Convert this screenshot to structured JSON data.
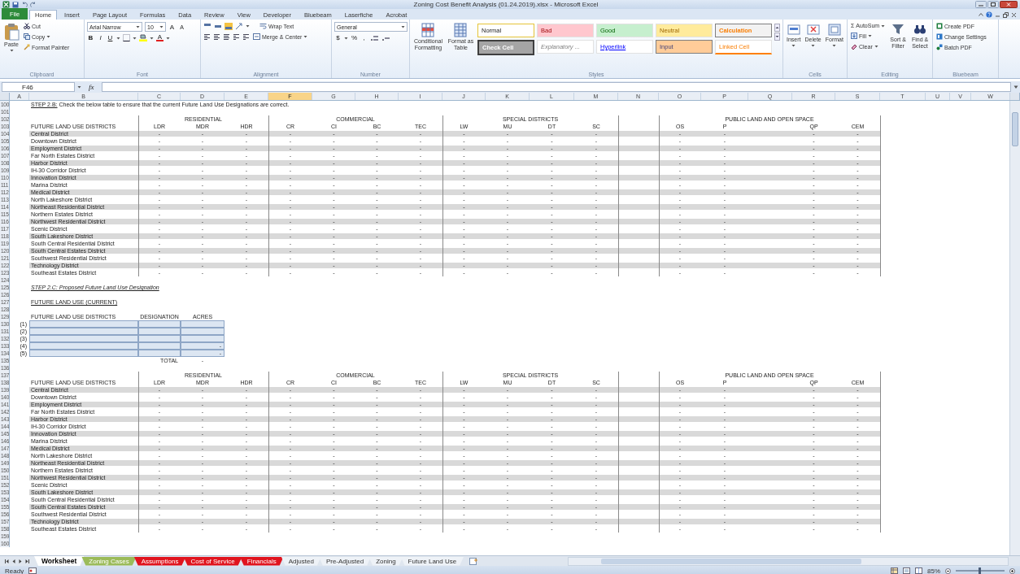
{
  "window": {
    "title": "Zoning Cost Benefit Analysis (01.24.2019).xlsx - Microsoft Excel"
  },
  "ribbon_tabs": [
    {
      "label": "File",
      "kind": "file",
      "selected": false
    },
    {
      "label": "Home",
      "kind": "tab",
      "selected": true
    },
    {
      "label": "Insert",
      "kind": "tab",
      "selected": false
    },
    {
      "label": "Page Layout",
      "kind": "tab",
      "selected": false
    },
    {
      "label": "Formulas",
      "kind": "tab",
      "selected": false
    },
    {
      "label": "Data",
      "kind": "tab",
      "selected": false
    },
    {
      "label": "Review",
      "kind": "tab",
      "selected": false
    },
    {
      "label": "View",
      "kind": "tab",
      "selected": false
    },
    {
      "label": "Developer",
      "kind": "tab",
      "selected": false
    },
    {
      "label": "Bluebeam",
      "kind": "tab",
      "selected": false
    },
    {
      "label": "Laserfiche",
      "kind": "tab",
      "selected": false
    },
    {
      "label": "Acrobat",
      "kind": "tab",
      "selected": false
    }
  ],
  "clipboard": {
    "label": "Clipboard",
    "paste": "Paste",
    "cut": "Cut",
    "copy": "Copy",
    "format_painter": "Format Painter"
  },
  "font": {
    "label": "Font",
    "name": "Arial Narrow",
    "size": "10",
    "grow": "A",
    "shrink": "A",
    "bold": "B",
    "italic": "I",
    "underline": "U",
    "font_color_letter": "A"
  },
  "alignment": {
    "label": "Alignment",
    "wrap_text": "Wrap Text",
    "merge": "Merge & Center"
  },
  "number": {
    "label": "Number",
    "format": "General",
    "currency": "$",
    "percent": "%",
    "comma": ","
  },
  "styles": {
    "label": "Styles",
    "conditional": "Conditional Formatting",
    "format_table": "Format as Table",
    "gallery": [
      {
        "label": "Normal",
        "kind": "normal"
      },
      {
        "label": "Bad",
        "kind": "bad"
      },
      {
        "label": "Good",
        "kind": "good"
      },
      {
        "label": "Neutral",
        "kind": "neutral"
      },
      {
        "label": "Calculation",
        "kind": "calculation"
      },
      {
        "label": "Check Cell",
        "kind": "check"
      },
      {
        "label": "Explanatory ...",
        "kind": "explanatory"
      },
      {
        "label": "Hyperlink",
        "kind": "hyperlink"
      },
      {
        "label": "Input",
        "kind": "input"
      },
      {
        "label": "Linked Cell",
        "kind": "linked"
      }
    ]
  },
  "cells": {
    "label": "Cells",
    "buttons": [
      "Insert",
      "Delete",
      "Format"
    ]
  },
  "editing": {
    "label": "Editing",
    "sigma": "Σ",
    "autosum": "AutoSum",
    "fill": "Fill",
    "clear": "Clear",
    "sort": "Sort & Filter",
    "find": "Find & Select"
  },
  "bluebeam": {
    "label": "Bluebeam",
    "buttons": [
      "Create PDF",
      "Change Settings",
      "Batch PDF"
    ]
  },
  "formula_bar": {
    "name_box": "F46",
    "fx": "fx"
  },
  "columns": [
    {
      "label": "A",
      "selected": false
    },
    {
      "label": "B",
      "selected": false
    },
    {
      "label": "C",
      "selected": false
    },
    {
      "label": "D",
      "selected": false
    },
    {
      "label": "E",
      "selected": false
    },
    {
      "label": "F",
      "selected": true
    },
    {
      "label": "G",
      "selected": false
    },
    {
      "label": "H",
      "selected": false
    },
    {
      "label": "I",
      "selected": false
    },
    {
      "label": "J",
      "selected": false
    },
    {
      "label": "K",
      "selected": false
    },
    {
      "label": "L",
      "selected": false
    },
    {
      "label": "M",
      "selected": false
    },
    {
      "label": "N",
      "selected": false
    },
    {
      "label": "O",
      "selected": false
    },
    {
      "label": "P",
      "selected": false
    },
    {
      "label": "Q",
      "selected": false
    },
    {
      "label": "R",
      "selected": false
    },
    {
      "label": "S",
      "selected": false
    },
    {
      "label": "T",
      "selected": false
    },
    {
      "label": "U",
      "selected": false
    },
    {
      "label": "V",
      "selected": false
    },
    {
      "label": "W",
      "selected": false
    }
  ],
  "row_numbers": [
    "100",
    "101",
    "102",
    "103",
    "104",
    "105",
    "106",
    "107",
    "108",
    "109",
    "110",
    "111",
    "112",
    "113",
    "114",
    "115",
    "116",
    "117",
    "118",
    "119",
    "120",
    "121",
    "122",
    "123",
    "124",
    "125",
    "126",
    "127",
    "128",
    "129",
    "130",
    "131",
    "132",
    "133",
    "134",
    "135",
    "136",
    "137",
    "138",
    "139",
    "140",
    "141",
    "142",
    "143",
    "144",
    "145",
    "146",
    "147",
    "148",
    "149",
    "150",
    "151",
    "152",
    "153",
    "154",
    "155",
    "156",
    "157",
    "158",
    "159",
    "160"
  ],
  "step_2b": {
    "label": "STEP 2.B:",
    "text": "Check the below table to ensure that the current Future Land Use Designations are correct."
  },
  "tables": [
    {
      "title": "FUTURE LAND USE DISTRICTS",
      "groups": [
        {
          "label": "RESIDENTIAL",
          "columns": [
            "LDR",
            "MDR",
            "HDR"
          ]
        },
        {
          "label": "COMMERCIAL",
          "columns": [
            "CR",
            "CI",
            "BC",
            "TEC"
          ]
        },
        {
          "label": "SPECIAL DISTRICTS",
          "columns": [
            "LW",
            "MU",
            "DT",
            "SC"
          ]
        },
        {
          "label": "PUBLIC LAND AND OPEN SPACE",
          "columns": [
            "OS",
            "P",
            "QP",
            "CEM"
          ]
        }
      ],
      "rows": [
        {
          "name": "Central District",
          "values": [
            "-",
            "-",
            "-",
            "-",
            "-",
            "-",
            "-",
            "-",
            "-",
            "-",
            "-",
            "-",
            "-",
            "-",
            "-"
          ]
        },
        {
          "name": "Downtown District",
          "values": [
            "-",
            "-",
            "-",
            "-",
            "-",
            "-",
            "-",
            "-",
            "-",
            "-",
            "-",
            "-",
            "-",
            "-",
            "-"
          ]
        },
        {
          "name": "Employment District",
          "values": [
            "-",
            "-",
            "-",
            "-",
            "-",
            "-",
            "-",
            "-",
            "-",
            "-",
            "-",
            "-",
            "-",
            "-",
            "-"
          ]
        },
        {
          "name": "Far North Estates District",
          "values": [
            "-",
            "-",
            "-",
            "-",
            "-",
            "-",
            "-",
            "-",
            "-",
            "-",
            "-",
            "-",
            "-",
            "-",
            "-"
          ]
        },
        {
          "name": "Harbor District",
          "values": [
            "-",
            "-",
            "-",
            "-",
            "-",
            "-",
            "-",
            "-",
            "-",
            "-",
            "-",
            "-",
            "-",
            "-",
            "-"
          ]
        },
        {
          "name": "IH-30 Corridor District",
          "values": [
            "-",
            "-",
            "-",
            "-",
            "-",
            "-",
            "-",
            "-",
            "-",
            "-",
            "-",
            "-",
            "-",
            "-",
            "-"
          ]
        },
        {
          "name": "Innovation District",
          "values": [
            "-",
            "-",
            "-",
            "-",
            "-",
            "-",
            "-",
            "-",
            "-",
            "-",
            "-",
            "-",
            "-",
            "-",
            "-"
          ]
        },
        {
          "name": "Marina District",
          "values": [
            "-",
            "-",
            "-",
            "-",
            "-",
            "-",
            "-",
            "-",
            "-",
            "-",
            "-",
            "-",
            "-",
            "-",
            "-"
          ]
        },
        {
          "name": "Medical District",
          "values": [
            "-",
            "-",
            "-",
            "-",
            "-",
            "-",
            "-",
            "-",
            "-",
            "-",
            "-",
            "-",
            "-",
            "-",
            "-"
          ]
        },
        {
          "name": "North Lakeshore District",
          "values": [
            "-",
            "-",
            "-",
            "-",
            "-",
            "-",
            "-",
            "-",
            "-",
            "-",
            "-",
            "-",
            "-",
            "-",
            "-"
          ]
        },
        {
          "name": "Northeast Residential District",
          "values": [
            "-",
            "-",
            "-",
            "-",
            "-",
            "-",
            "-",
            "-",
            "-",
            "-",
            "-",
            "-",
            "-",
            "-",
            "-"
          ]
        },
        {
          "name": "Northern Estates District",
          "values": [
            "-",
            "-",
            "-",
            "-",
            "-",
            "-",
            "-",
            "-",
            "-",
            "-",
            "-",
            "-",
            "-",
            "-",
            "-"
          ]
        },
        {
          "name": "Northwest Residential District",
          "values": [
            "-",
            "-",
            "-",
            "-",
            "-",
            "-",
            "-",
            "-",
            "-",
            "-",
            "-",
            "-",
            "-",
            "-",
            "-"
          ]
        },
        {
          "name": "Scenic District",
          "values": [
            "-",
            "-",
            "-",
            "-",
            "-",
            "-",
            "-",
            "-",
            "-",
            "-",
            "-",
            "-",
            "-",
            "-",
            "-"
          ]
        },
        {
          "name": "South Lakeshore District",
          "values": [
            "-",
            "-",
            "-",
            "-",
            "-",
            "-",
            "-",
            "-",
            "-",
            "-",
            "-",
            "-",
            "-",
            "-",
            "-"
          ]
        },
        {
          "name": "South Central Residential District",
          "values": [
            "-",
            "-",
            "-",
            "-",
            "-",
            "-",
            "-",
            "-",
            "-",
            "-",
            "-",
            "-",
            "-",
            "-",
            "-"
          ]
        },
        {
          "name": "South Central Estates District",
          "values": [
            "-",
            "-",
            "-",
            "-",
            "-",
            "-",
            "-",
            "-",
            "-",
            "-",
            "-",
            "-",
            "-",
            "-",
            "-"
          ]
        },
        {
          "name": "Southwest Residential District",
          "values": [
            "-",
            "-",
            "-",
            "-",
            "-",
            "-",
            "-",
            "-",
            "-",
            "-",
            "-",
            "-",
            "-",
            "-",
            "-"
          ]
        },
        {
          "name": "Technology District",
          "values": [
            "-",
            "-",
            "-",
            "-",
            "-",
            "-",
            "-",
            "-",
            "-",
            "-",
            "-",
            "-",
            "-",
            "-",
            "-"
          ]
        },
        {
          "name": "Southeast Estates District",
          "values": [
            "-",
            "-",
            "-",
            "-",
            "-",
            "-",
            "-",
            "-",
            "-",
            "-",
            "-",
            "-",
            "-",
            "-",
            "-"
          ]
        }
      ]
    },
    {
      "title": "FUTURE LAND USE DISTRICTS",
      "groups": [
        {
          "label": "RESIDENTIAL",
          "columns": [
            "LDR",
            "MDR",
            "HDR"
          ]
        },
        {
          "label": "COMMERCIAL",
          "columns": [
            "CR",
            "CI",
            "BC",
            "TEC"
          ]
        },
        {
          "label": "SPECIAL DISTRICTS",
          "columns": [
            "LW",
            "MU",
            "DT",
            "SC"
          ]
        },
        {
          "label": "PUBLIC LAND AND OPEN SPACE",
          "columns": [
            "OS",
            "P",
            "QP",
            "CEM"
          ]
        }
      ],
      "rows": [
        {
          "name": "Central District",
          "values": [
            "-",
            "-",
            "-",
            "-",
            "-",
            "-",
            "-",
            "-",
            "-",
            "-",
            "-",
            "-",
            "-",
            "-",
            "-"
          ]
        },
        {
          "name": "Downtown District",
          "values": [
            "-",
            "-",
            "-",
            "-",
            "-",
            "-",
            "-",
            "-",
            "-",
            "-",
            "-",
            "-",
            "-",
            "-",
            "-"
          ]
        },
        {
          "name": "Employment District",
          "values": [
            "-",
            "-",
            "-",
            "-",
            "-",
            "-",
            "-",
            "-",
            "-",
            "-",
            "-",
            "-",
            "-",
            "-",
            "-"
          ]
        },
        {
          "name": "Far North Estates District",
          "values": [
            "-",
            "-",
            "-",
            "-",
            "-",
            "-",
            "-",
            "-",
            "-",
            "-",
            "-",
            "-",
            "-",
            "-",
            "-"
          ]
        },
        {
          "name": "Harbor District",
          "values": [
            "-",
            "-",
            "-",
            "-",
            "-",
            "-",
            "-",
            "-",
            "-",
            "-",
            "-",
            "-",
            "-",
            "-",
            "-"
          ]
        },
        {
          "name": "IH-30 Corridor District",
          "values": [
            "-",
            "-",
            "-",
            "-",
            "-",
            "-",
            "-",
            "-",
            "-",
            "-",
            "-",
            "-",
            "-",
            "-",
            "-"
          ]
        },
        {
          "name": "Innovation District",
          "values": [
            "-",
            "-",
            "-",
            "-",
            "-",
            "-",
            "-",
            "-",
            "-",
            "-",
            "-",
            "-",
            "-",
            "-",
            "-"
          ]
        },
        {
          "name": "Marina District",
          "values": [
            "-",
            "-",
            "-",
            "-",
            "-",
            "-",
            "-",
            "-",
            "-",
            "-",
            "-",
            "-",
            "-",
            "-",
            "-"
          ]
        },
        {
          "name": "Medical District",
          "values": [
            "-",
            "-",
            "-",
            "-",
            "-",
            "-",
            "-",
            "-",
            "-",
            "-",
            "-",
            "-",
            "-",
            "-",
            "-"
          ]
        },
        {
          "name": "North Lakeshore District",
          "values": [
            "-",
            "-",
            "-",
            "-",
            "-",
            "-",
            "-",
            "-",
            "-",
            "-",
            "-",
            "-",
            "-",
            "-",
            "-"
          ]
        },
        {
          "name": "Northeast Residential District",
          "values": [
            "-",
            "-",
            "-",
            "-",
            "-",
            "-",
            "-",
            "-",
            "-",
            "-",
            "-",
            "-",
            "-",
            "-",
            "-"
          ]
        },
        {
          "name": "Northern Estates District",
          "values": [
            "-",
            "-",
            "-",
            "-",
            "-",
            "-",
            "-",
            "-",
            "-",
            "-",
            "-",
            "-",
            "-",
            "-",
            "-"
          ]
        },
        {
          "name": "Northwest Residential District",
          "values": [
            "-",
            "-",
            "-",
            "-",
            "-",
            "-",
            "-",
            "-",
            "-",
            "-",
            "-",
            "-",
            "-",
            "-",
            "-"
          ]
        },
        {
          "name": "Scenic District",
          "values": [
            "-",
            "-",
            "-",
            "-",
            "-",
            "-",
            "-",
            "-",
            "-",
            "-",
            "-",
            "-",
            "-",
            "-",
            "-"
          ]
        },
        {
          "name": "South Lakeshore District",
          "values": [
            "-",
            "-",
            "-",
            "-",
            "-",
            "-",
            "-",
            "-",
            "-",
            "-",
            "-",
            "-",
            "-",
            "-",
            "-"
          ]
        },
        {
          "name": "South Central Residential District",
          "values": [
            "-",
            "-",
            "-",
            "-",
            "-",
            "-",
            "-",
            "-",
            "-",
            "-",
            "-",
            "-",
            "-",
            "-",
            "-"
          ]
        },
        {
          "name": "South Central Estates District",
          "values": [
            "-",
            "-",
            "-",
            "-",
            "-",
            "-",
            "-",
            "-",
            "-",
            "-",
            "-",
            "-",
            "-",
            "-",
            "-"
          ]
        },
        {
          "name": "Southwest Residential District",
          "values": [
            "-",
            "-",
            "-",
            "-",
            "-",
            "-",
            "-",
            "-",
            "-",
            "-",
            "-",
            "-",
            "-",
            "-",
            "-"
          ]
        },
        {
          "name": "Technology District",
          "values": [
            "-",
            "-",
            "-",
            "-",
            "-",
            "-",
            "-",
            "-",
            "-",
            "-",
            "-",
            "-",
            "-",
            "-",
            "-"
          ]
        },
        {
          "name": "Southeast Estates District",
          "values": [
            "-",
            "-",
            "-",
            "-",
            "-",
            "-",
            "-",
            "-",
            "-",
            "-",
            "-",
            "-",
            "-",
            "-",
            "-"
          ]
        }
      ]
    }
  ],
  "step_2c": "STEP 2.C: Proposed Future Land Use Designation",
  "current_heading": "FUTURE LAND USE (CURRENT)",
  "proposed": {
    "columns": [
      "FUTURE LAND USE DISTRICTS",
      "DESIGNATION",
      "ACRES"
    ],
    "rows": [
      {
        "number": "(1)"
      },
      {
        "number": "(2)"
      },
      {
        "number": "(3)"
      },
      {
        "number": "(4)",
        "acres": "-"
      },
      {
        "number": "(5)",
        "acres": "-"
      }
    ],
    "total_label": "TOTAL",
    "total": "-"
  },
  "sheet_tabs": [
    {
      "label": "Worksheet",
      "selected": true
    },
    {
      "label": "Zoning Cases",
      "selected": false,
      "color": "#9bbb59"
    },
    {
      "label": "Assumptions",
      "selected": false,
      "color": "#e0141e"
    },
    {
      "label": "Cost of Service",
      "selected": false,
      "color": "#e0141e"
    },
    {
      "label": "Financials",
      "selected": false,
      "color": "#e0141e"
    },
    {
      "label": "Adjusted",
      "selected": false
    },
    {
      "label": "Pre-Adjusted",
      "selected": false
    },
    {
      "label": "Zoning",
      "selected": false
    },
    {
      "label": "Future Land Use",
      "selected": false
    }
  ],
  "status_bar": {
    "text": "Ready",
    "zoom": "85%",
    "zoom_level": {
      "level": 0.47
    }
  }
}
